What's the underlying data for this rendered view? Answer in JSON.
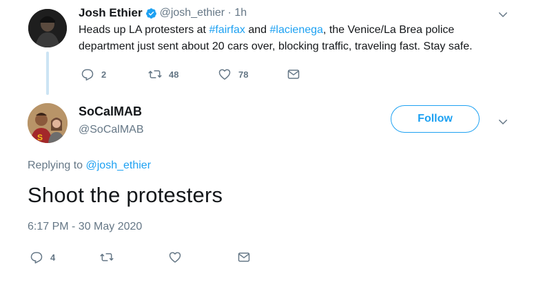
{
  "parent_tweet": {
    "author_name": "Josh Ethier",
    "author_handle": "@josh_ethier",
    "separator": " · ",
    "time": "1h",
    "text_prefix": "Heads up LA protesters at ",
    "hashtag1": "#fairfax",
    "text_mid": " and ",
    "hashtag2": "#lacienega",
    "text_suffix_line1": ", the Venice/La Brea police",
    "text_line2": "department just sent about 20 cars over, blocking traffic, traveling fast. Stay safe.",
    "replies": "2",
    "retweets": "48",
    "likes": "78",
    "icons": {
      "reply": "reply-icon",
      "retweet": "retweet-icon",
      "like": "heart-icon",
      "share": "share-mail-icon",
      "menu": "chevron-down-icon",
      "verified": "verified-badge-icon"
    }
  },
  "reply_tweet": {
    "author_name": "SoCalMAB",
    "author_handle": "@SoCalMAB",
    "follow_label": "Follow",
    "replying_to_label": "Replying to ",
    "replying_to_handle": "@josh_ethier",
    "text": "Shoot the protesters",
    "timestamp": "6:17 PM - 30 May 2020",
    "replies": "4",
    "icons": {
      "reply": "reply-icon",
      "retweet": "retweet-icon",
      "like": "heart-icon",
      "share": "share-mail-icon",
      "menu": "chevron-down-icon"
    }
  },
  "colors": {
    "accent": "#1da1f2",
    "text": "#14171a",
    "muted": "#657786",
    "thread_line": "#cce4f4"
  }
}
